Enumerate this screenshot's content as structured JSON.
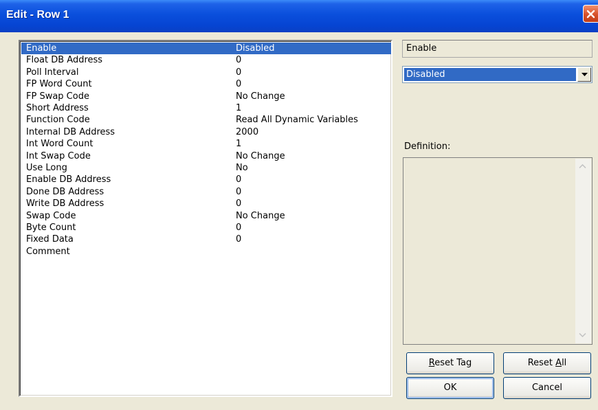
{
  "window": {
    "title": "Edit - Row 1"
  },
  "rows": [
    {
      "key": "Enable",
      "value": "Disabled"
    },
    {
      "key": "Float DB Address",
      "value": "0"
    },
    {
      "key": "Poll Interval",
      "value": "0"
    },
    {
      "key": "FP Word Count",
      "value": "0"
    },
    {
      "key": "FP Swap Code",
      "value": "No Change"
    },
    {
      "key": "Short Address",
      "value": "1"
    },
    {
      "key": "Function Code",
      "value": "Read All Dynamic Variables"
    },
    {
      "key": "Internal DB Address",
      "value": "2000"
    },
    {
      "key": "Int Word Count",
      "value": "1"
    },
    {
      "key": "Int Swap Code",
      "value": "No Change"
    },
    {
      "key": "Use Long",
      "value": "No"
    },
    {
      "key": "Enable DB Address",
      "value": "0"
    },
    {
      "key": "Done DB Address",
      "value": "0"
    },
    {
      "key": "Write DB Address",
      "value": "0"
    },
    {
      "key": "Swap Code",
      "value": "No Change"
    },
    {
      "key": "Byte Count",
      "value": "0"
    },
    {
      "key": "Fixed Data",
      "value": "0"
    },
    {
      "key": "Comment",
      "value": ""
    }
  ],
  "selected_field": {
    "name": "Enable",
    "value": "Disabled"
  },
  "definition": {
    "label": "Definition:",
    "text": ""
  },
  "buttons": {
    "reset_tag_pre": "",
    "reset_tag_ul": "R",
    "reset_tag_post": "eset Tag",
    "reset_all_pre": "Reset ",
    "reset_all_ul": "A",
    "reset_all_post": "ll",
    "ok": "OK",
    "cancel": "Cancel"
  },
  "colors": {
    "selection": "#316AC5",
    "titlebar": "#0A4FDC",
    "dialog_bg": "#ECE9D8"
  },
  "icons": {
    "close": "close-icon",
    "dropdown": "chevron-down-icon",
    "scroll_up": "scroll-up-icon",
    "scroll_down": "scroll-down-icon"
  }
}
